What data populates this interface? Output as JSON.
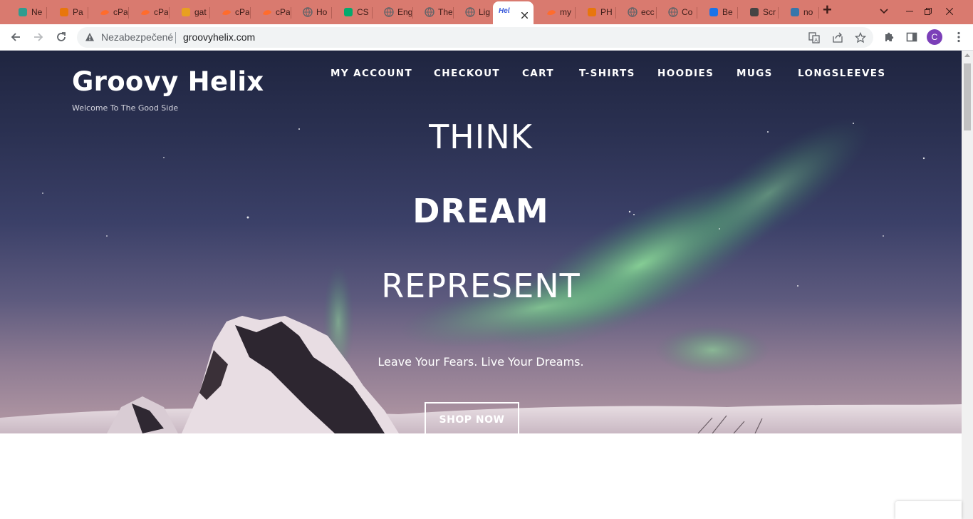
{
  "browser": {
    "tabs": [
      {
        "label": "Ne",
        "icon": "netlify-icon",
        "color": "#2f9c8f"
      },
      {
        "label": "Pa",
        "icon": "t-logo-icon",
        "color": "#e8760c"
      },
      {
        "label": "cPa",
        "icon": "cpanel-icon",
        "color": "#ff6c2c"
      },
      {
        "label": "cPa",
        "icon": "cpanel-icon",
        "color": "#ff6c2c"
      },
      {
        "label": "gat",
        "icon": "gatsby-icon",
        "color": "#e8a020"
      },
      {
        "label": "cPa",
        "icon": "cpanel-icon",
        "color": "#ff6c2c"
      },
      {
        "label": "cPa",
        "icon": "cpanel-icon",
        "color": "#ff6c2c"
      },
      {
        "label": "Ho",
        "icon": "globe-icon",
        "color": "#5f6368"
      },
      {
        "label": "CS",
        "icon": "w-logo-icon",
        "color": "#04aa6d"
      },
      {
        "label": "Eng",
        "icon": "globe-icon",
        "color": "#5f6368"
      },
      {
        "label": "The",
        "icon": "globe-icon",
        "color": "#5f6368"
      },
      {
        "label": "Lig",
        "icon": "globe-icon",
        "color": "#5f6368"
      },
      {
        "label": "Heli",
        "icon": "helix-icon",
        "color": "#3b5bdb",
        "active": true
      },
      {
        "label": "my",
        "icon": "cpanel-icon",
        "color": "#ff6c2c"
      },
      {
        "label": "PH",
        "icon": "php-icon",
        "color": "#e8760c"
      },
      {
        "label": "ecc",
        "icon": "globe-icon",
        "color": "#5f6368"
      },
      {
        "label": "Co",
        "icon": "globe-icon",
        "color": "#5f6368"
      },
      {
        "label": "Be",
        "icon": "b-logo-icon",
        "color": "#1a73e8"
      },
      {
        "label": "Scr",
        "icon": "p-logo-icon",
        "color": "#444444"
      },
      {
        "label": "no",
        "icon": "python-icon",
        "color": "#3776ab"
      }
    ],
    "new_tab_symbol": "+",
    "tab_search_symbol": "⌄",
    "security_label": "Nezabezpečené",
    "url": "groovyhelix.com",
    "profile_initial": "C",
    "colors": {
      "tabstrip": "#d97a6f",
      "profile": "#7b3fb8"
    }
  },
  "site": {
    "title": "Groovy Helix",
    "tagline": "Welcome To The Good Side",
    "nav": [
      {
        "label": "MY ACCOUNT"
      },
      {
        "label": "CHECKOUT"
      },
      {
        "label": "CART"
      },
      {
        "label": "T-SHIRTS"
      },
      {
        "label": "HOODIES"
      },
      {
        "label": "MUGS"
      },
      {
        "label": "LONGSLEEVES"
      }
    ],
    "hero": {
      "line1": "THINK",
      "line2": "DREAM",
      "line3": "REPRESENT",
      "subtitle": "Leave Your Fears. Live Your Dreams.",
      "cta": "SHOP NOW"
    }
  }
}
